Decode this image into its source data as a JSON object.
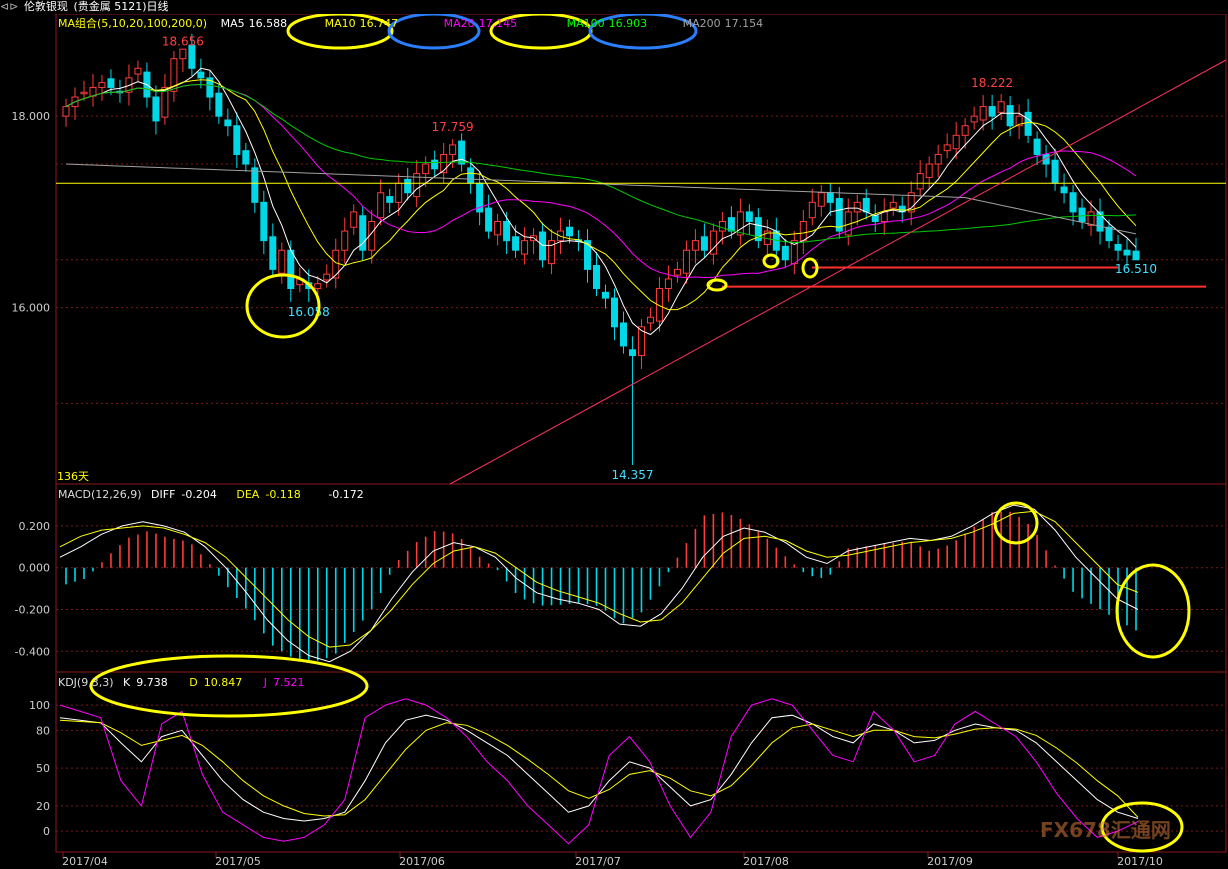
{
  "title_bar": {
    "icon": "toggle-arrows-icon",
    "symbol": "伦敦银现",
    "market": "(贵金属 5121)日线"
  },
  "ma_legend": {
    "group": "MA组合(5,10,20,100,200,0)",
    "items": [
      {
        "label": "MA5",
        "value": "16.588",
        "color": "#ffffff"
      },
      {
        "label": "MA10",
        "value": "16.747",
        "color": "#ffff00"
      },
      {
        "label": "MA20",
        "value": "17.145",
        "color": "#ff00ff"
      },
      {
        "label": "MA100",
        "value": "16.903",
        "color": "#00ff00"
      },
      {
        "label": "MA200",
        "value": "17.154",
        "color": "#a0a0a0"
      }
    ]
  },
  "macd_legend": {
    "name": "MACD(12,26,9)",
    "diff_label": "DIFF",
    "diff": "-0.204",
    "dea_label": "DEA",
    "dea": "-0.118",
    "macd": "-0.172"
  },
  "kdj_legend": {
    "name": "KDJ(9,3,3)",
    "k_label": "K",
    "k": "9.738",
    "d_label": "D",
    "d": "10.847",
    "j_label": "J",
    "j": "7.521"
  },
  "days_label": "136天",
  "watermark": "FX678汇通网",
  "colors": {
    "up": "#ff3b3b",
    "down": "#00d8e8",
    "ma5": "#ffffff",
    "ma10": "#ffff00",
    "ma20": "#ff00ff",
    "ma100": "#00cc00",
    "ma200": "#a0a0a0",
    "annot_yellow": "#ffff00",
    "annot_blue": "#2a7fff",
    "trend": "#ff3060",
    "grid": "#7a1a1a"
  },
  "chart_data": [
    {
      "type": "candlestick",
      "title": "伦敦银现 日线",
      "ylim": [
        14.2,
        18.9
      ],
      "y_ticks": [
        "18.000",
        "16.000"
      ],
      "x_ticks": [
        "2017/04",
        "2017/05",
        "2017/06",
        "2017/07",
        "2017/08",
        "2017/09",
        "2017/10"
      ],
      "annotations": [
        {
          "text": "18.656",
          "kind": "high"
        },
        {
          "text": "16.058",
          "kind": "low"
        },
        {
          "text": "17.759",
          "kind": "high"
        },
        {
          "text": "14.357",
          "kind": "low"
        },
        {
          "text": "18.222",
          "kind": "high"
        },
        {
          "text": "16.510",
          "kind": "low"
        }
      ],
      "horizontal_lines": [
        {
          "y": 17.3,
          "color": "yellow"
        },
        {
          "y": 16.42,
          "color": "red"
        },
        {
          "y": 16.22,
          "color": "red"
        }
      ],
      "trendline": {
        "from": [
          "2017/07",
          14.2
        ],
        "to": [
          "2017/10",
          18.5
        ]
      },
      "closes": [
        18.1,
        18.2,
        18.25,
        18.3,
        18.35,
        18.3,
        18.25,
        18.4,
        18.5,
        18.2,
        17.95,
        18.3,
        18.6,
        18.7,
        18.5,
        18.4,
        18.2,
        18.0,
        17.9,
        17.6,
        17.5,
        17.1,
        16.7,
        16.4,
        16.6,
        16.2,
        16.3,
        16.2,
        16.25,
        16.35,
        16.6,
        16.8,
        17.0,
        16.6,
        16.9,
        17.2,
        17.1,
        17.3,
        17.2,
        17.4,
        17.5,
        17.45,
        17.6,
        17.7,
        17.5,
        17.3,
        17.0,
        16.8,
        16.9,
        16.7,
        16.6,
        16.7,
        16.75,
        16.5,
        16.7,
        16.8,
        16.75,
        16.7,
        16.4,
        16.2,
        16.1,
        15.8,
        15.6,
        15.5,
        15.8,
        15.9,
        16.2,
        16.3,
        16.4,
        16.6,
        16.7,
        16.6,
        16.8,
        16.9,
        16.8,
        17.0,
        16.9,
        16.7,
        16.8,
        16.6,
        16.5,
        16.7,
        16.9,
        17.1,
        17.2,
        17.1,
        16.8,
        17.0,
        17.1,
        17.0,
        16.9,
        17.0,
        17.1,
        17.0,
        17.2,
        17.4,
        17.5,
        17.6,
        17.7,
        17.8,
        17.9,
        18.0,
        18.1,
        18.0,
        18.15,
        17.9,
        18.0,
        17.8,
        17.6,
        17.5,
        17.3,
        17.2,
        17.0,
        16.9,
        17.0,
        16.8,
        16.7,
        16.6,
        16.55,
        16.5
      ]
    },
    {
      "type": "bar_line",
      "title": "MACD(12,26,9)",
      "ylim": [
        -0.48,
        0.3
      ],
      "y_ticks": [
        "0.200",
        "0.000",
        "-0.200",
        "-0.400"
      ],
      "series": [
        {
          "name": "DIFF",
          "values": [
            0.05,
            0.1,
            0.16,
            0.2,
            0.22,
            0.2,
            0.17,
            0.1,
            0.0,
            -0.12,
            -0.25,
            -0.35,
            -0.42,
            -0.45,
            -0.4,
            -0.3,
            -0.15,
            -0.02,
            0.08,
            0.12,
            0.1,
            0.05,
            -0.05,
            -0.12,
            -0.15,
            -0.17,
            -0.2,
            -0.27,
            -0.28,
            -0.22,
            -0.1,
            0.05,
            0.15,
            0.19,
            0.17,
            0.12,
            0.05,
            0.02,
            0.08,
            0.1,
            0.12,
            0.14,
            0.13,
            0.15,
            0.2,
            0.26,
            0.3,
            0.28,
            0.18,
            0.05,
            -0.05,
            -0.15,
            -0.2
          ]
        },
        {
          "name": "DEA",
          "values": [
            0.1,
            0.15,
            0.18,
            0.19,
            0.2,
            0.19,
            0.16,
            0.12,
            0.05,
            -0.05,
            -0.15,
            -0.25,
            -0.33,
            -0.38,
            -0.37,
            -0.3,
            -0.2,
            -0.08,
            0.02,
            0.08,
            0.1,
            0.07,
            0.0,
            -0.07,
            -0.11,
            -0.14,
            -0.17,
            -0.22,
            -0.26,
            -0.25,
            -0.17,
            -0.05,
            0.07,
            0.14,
            0.15,
            0.13,
            0.08,
            0.05,
            0.06,
            0.08,
            0.1,
            0.12,
            0.13,
            0.14,
            0.17,
            0.21,
            0.26,
            0.27,
            0.22,
            0.12,
            0.02,
            -0.08,
            -0.118
          ]
        }
      ]
    },
    {
      "type": "line",
      "title": "KDJ(9,3,3)",
      "ylim": [
        -15,
        112
      ],
      "y_ticks": [
        "100",
        "80",
        "50",
        "20",
        "0"
      ],
      "series": [
        {
          "name": "K",
          "values": [
            90,
            88,
            86,
            70,
            55,
            75,
            80,
            60,
            40,
            25,
            15,
            10,
            8,
            10,
            15,
            40,
            70,
            88,
            92,
            88,
            80,
            70,
            60,
            45,
            30,
            15,
            20,
            40,
            55,
            50,
            35,
            20,
            25,
            45,
            70,
            90,
            92,
            85,
            75,
            70,
            85,
            80,
            70,
            72,
            80,
            85,
            82,
            80,
            70,
            55,
            40,
            25,
            15,
            10
          ]
        },
        {
          "name": "D",
          "values": [
            88,
            87,
            86,
            78,
            68,
            72,
            76,
            68,
            55,
            40,
            28,
            20,
            14,
            12,
            13,
            25,
            45,
            65,
            80,
            86,
            84,
            77,
            68,
            57,
            45,
            32,
            26,
            33,
            45,
            48,
            42,
            32,
            28,
            36,
            52,
            70,
            82,
            85,
            80,
            75,
            80,
            80,
            75,
            74,
            77,
            81,
            82,
            81,
            76,
            66,
            54,
            40,
            28,
            10.847
          ]
        },
        {
          "name": "J",
          "values": [
            100,
            95,
            90,
            40,
            20,
            85,
            95,
            45,
            15,
            5,
            -5,
            -8,
            -5,
            5,
            25,
            90,
            100,
            105,
            100,
            90,
            75,
            55,
            40,
            20,
            5,
            -10,
            5,
            60,
            75,
            55,
            20,
            -5,
            15,
            75,
            100,
            105,
            100,
            80,
            60,
            55,
            95,
            80,
            55,
            60,
            85,
            95,
            85,
            75,
            55,
            30,
            10,
            -5,
            0,
            7.521
          ]
        }
      ]
    }
  ]
}
